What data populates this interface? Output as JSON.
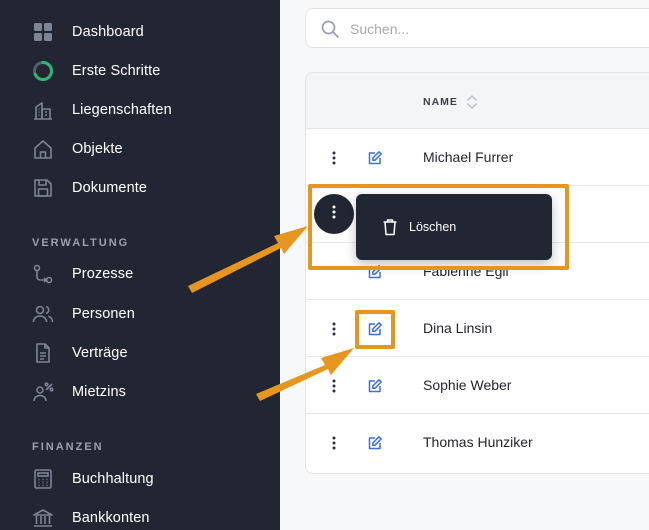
{
  "search": {
    "placeholder": "Suchen..."
  },
  "sidebar": {
    "items": [
      {
        "label": "Dashboard",
        "icon": "grid-icon"
      },
      {
        "label": "Erste Schritte",
        "icon": "progress-ring-icon"
      },
      {
        "label": "Liegenschaften",
        "icon": "buildings-icon"
      },
      {
        "label": "Objekte",
        "icon": "home-icon"
      },
      {
        "label": "Dokumente",
        "icon": "save-icon"
      }
    ],
    "sections": [
      {
        "title": "VERWALTUNG",
        "items": [
          {
            "label": "Prozesse",
            "icon": "process-icon"
          },
          {
            "label": "Personen",
            "icon": "users-icon"
          },
          {
            "label": "Verträge",
            "icon": "document-icon"
          },
          {
            "label": "Mietzins",
            "icon": "user-percent-icon"
          }
        ]
      },
      {
        "title": "FINANZEN",
        "items": [
          {
            "label": "Buchhaltung",
            "icon": "calculator-icon"
          },
          {
            "label": "Bankkonten",
            "icon": "bank-icon"
          }
        ]
      }
    ]
  },
  "table": {
    "columns": {
      "name": "NAME"
    },
    "rows": [
      {
        "name": "Michael Furrer"
      },
      {
        "name": ""
      },
      {
        "name": "Fabienne Egli"
      },
      {
        "name": "Dina Linsin"
      },
      {
        "name": "Sophie Weber"
      },
      {
        "name": "Thomas Hunziker"
      }
    ]
  },
  "context_menu": {
    "delete_label": "Löschen"
  },
  "colors": {
    "sidebar_bg": "#222632",
    "accent_ring": "#2bb673",
    "edit_icon": "#3b6fe0",
    "highlight": "#e6951f"
  }
}
